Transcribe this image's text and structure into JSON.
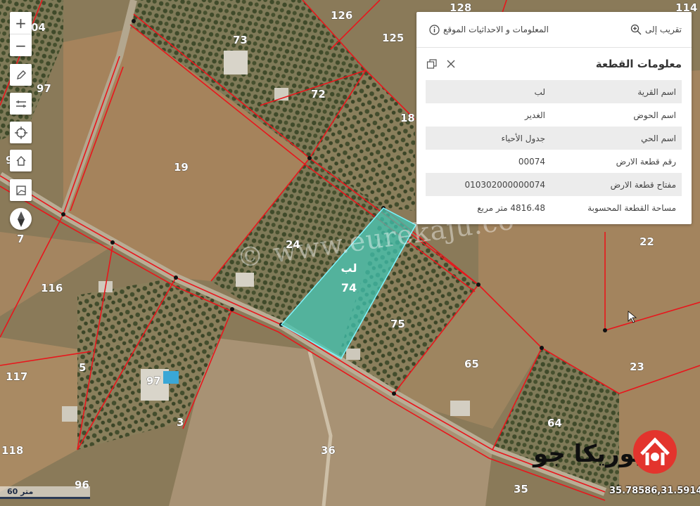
{
  "map": {
    "plot_numbers": [
      "04",
      "73",
      "126",
      "128",
      "114",
      "125",
      "97",
      "72",
      "18",
      "9",
      "19",
      "24",
      "7",
      "116",
      "22",
      "75",
      "117",
      "5",
      "97",
      "65",
      "23",
      "3",
      "64",
      "118",
      "36",
      "96",
      "35"
    ],
    "selected_plot": {
      "village": "لب",
      "number": "74"
    },
    "watermark": "© www.eurekaju.co",
    "scale_label": "60 متر",
    "coordinates": "35.78586,31.59143",
    "logo_text": "يوريكا جو"
  },
  "toolbar": {
    "zoom_in": "+",
    "zoom_out": "−",
    "tools": [
      "pencil-icon",
      "measure-icon",
      "locate-icon",
      "home-icon",
      "map-layer-icon",
      "compass-icon"
    ]
  },
  "panel": {
    "tab_zoom": "تقريب إلى",
    "tab_info": "المعلومات و الاحداثيات الموقع",
    "title": "معلومات القطعة",
    "rows": [
      {
        "key": "اسم القرية",
        "value": "لب"
      },
      {
        "key": "اسم الحوض",
        "value": "الغدير"
      },
      {
        "key": "اسم الحي",
        "value": "جدول الأحياء"
      },
      {
        "key": "رقم قطعة الارض",
        "value": "00074"
      },
      {
        "key": "مفتاح قطعة الارض",
        "value": "010302000000074"
      },
      {
        "key": "مساحة القطعة المحسوبة",
        "value": "4816.48 متر مربع"
      }
    ]
  },
  "colors": {
    "parcel_line": "#e8161c",
    "selection_fill": "#3fc7b5",
    "selection_stroke": "#7ff5ff",
    "logo_red": "#e3342d"
  }
}
